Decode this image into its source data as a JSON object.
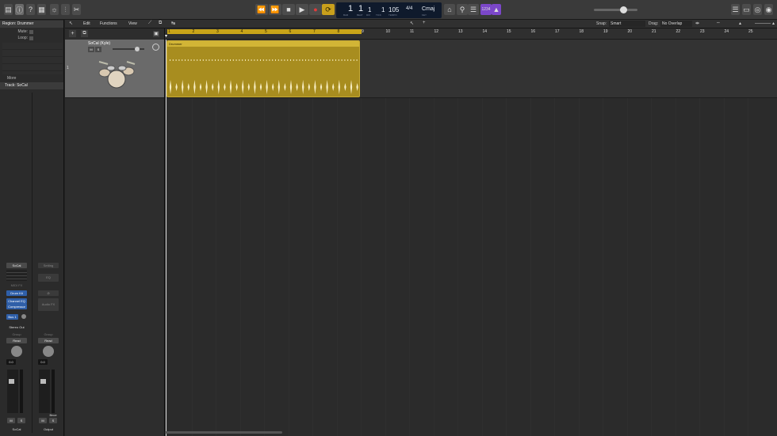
{
  "transport": {
    "position_bar": "1",
    "position_beat": "1",
    "position_div": "1",
    "position_tick": "1",
    "tempo": "105",
    "signature": "4/4",
    "key": "Cmaj",
    "count_in": "1234"
  },
  "transport_labels": {
    "bar": "BAR",
    "beat": "BEAT",
    "div": "DIV",
    "tick": "TICK",
    "tempo": "TEMPO",
    "key": "KEY"
  },
  "inspector": {
    "region_title": "Region: Drummer",
    "mute_label": "Mute:",
    "loop_label": "Loop:",
    "more_label": "More",
    "track_title": "Track: SoCal",
    "strip1": {
      "name": "SoCal",
      "midi_fx": "MIDI FX",
      "instrument": "Drum Kit",
      "fx1": "Channel EQ",
      "fx2": "Compressor",
      "send": "Bus 1",
      "output": "Stereo Out",
      "group": "Group",
      "automation": "Read",
      "volume": "0.0",
      "mute": "M",
      "solo": "S",
      "label": "SoCal"
    },
    "strip2": {
      "name": "Setting",
      "eq": "EQ",
      "audio_fx": "Audio FX",
      "group": "Group",
      "automation": "Read",
      "volume": "0.0",
      "mute": "M",
      "solo": "S",
      "label": "Output",
      "bounce": "Bnce"
    }
  },
  "menubar": {
    "edit": "Edit",
    "functions": "Functions",
    "view": "View",
    "snap_label": "Snap:",
    "snap_value": "Smart",
    "drag_label": "Drag:",
    "drag_value": "No Overlap"
  },
  "track": {
    "number": "1",
    "name": "SoCal (Kyle)",
    "mute": "M",
    "solo": "S"
  },
  "region": {
    "name": "Drummer"
  },
  "ruler": [
    "1",
    "2",
    "3",
    "4",
    "5",
    "6",
    "7",
    "8",
    "9",
    "10",
    "11",
    "12",
    "13",
    "14",
    "15",
    "16",
    "17",
    "18",
    "19",
    "20",
    "21",
    "22",
    "23",
    "24",
    "25"
  ]
}
